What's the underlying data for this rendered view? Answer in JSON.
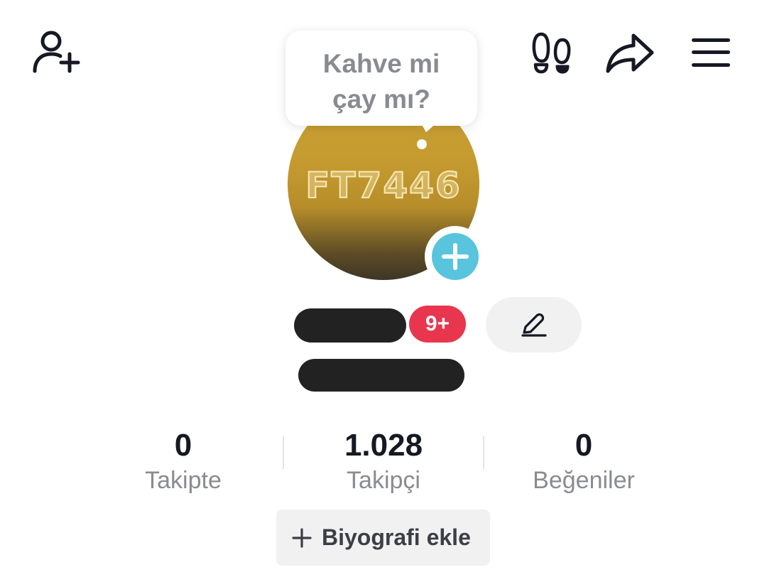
{
  "header": {
    "add_friend_icon": "person-plus-icon",
    "footprints_icon": "footprints-icon",
    "share_icon": "share-arrow-icon",
    "menu_icon": "hamburger-menu-icon"
  },
  "profile": {
    "note_bubble": "Kahve mi\nçay mı?",
    "avatar_text": "FT7446",
    "avatar_add_icon": "plus-icon",
    "notification_badge": "9+",
    "edit_icon": "pencil-icon"
  },
  "stats": [
    {
      "value": "0",
      "label": "Takipte"
    },
    {
      "value": "1.028",
      "label": "Takipçi"
    },
    {
      "value": "0",
      "label": "Beğeniler"
    }
  ],
  "bio_button": {
    "label": "Biyografi ekle",
    "icon": "plus-icon"
  },
  "colors": {
    "accent_cyan": "#58c4dd",
    "badge_red": "#e8364e",
    "avatar_gold": "#c59b30",
    "secondary_text": "#8a8b91"
  }
}
